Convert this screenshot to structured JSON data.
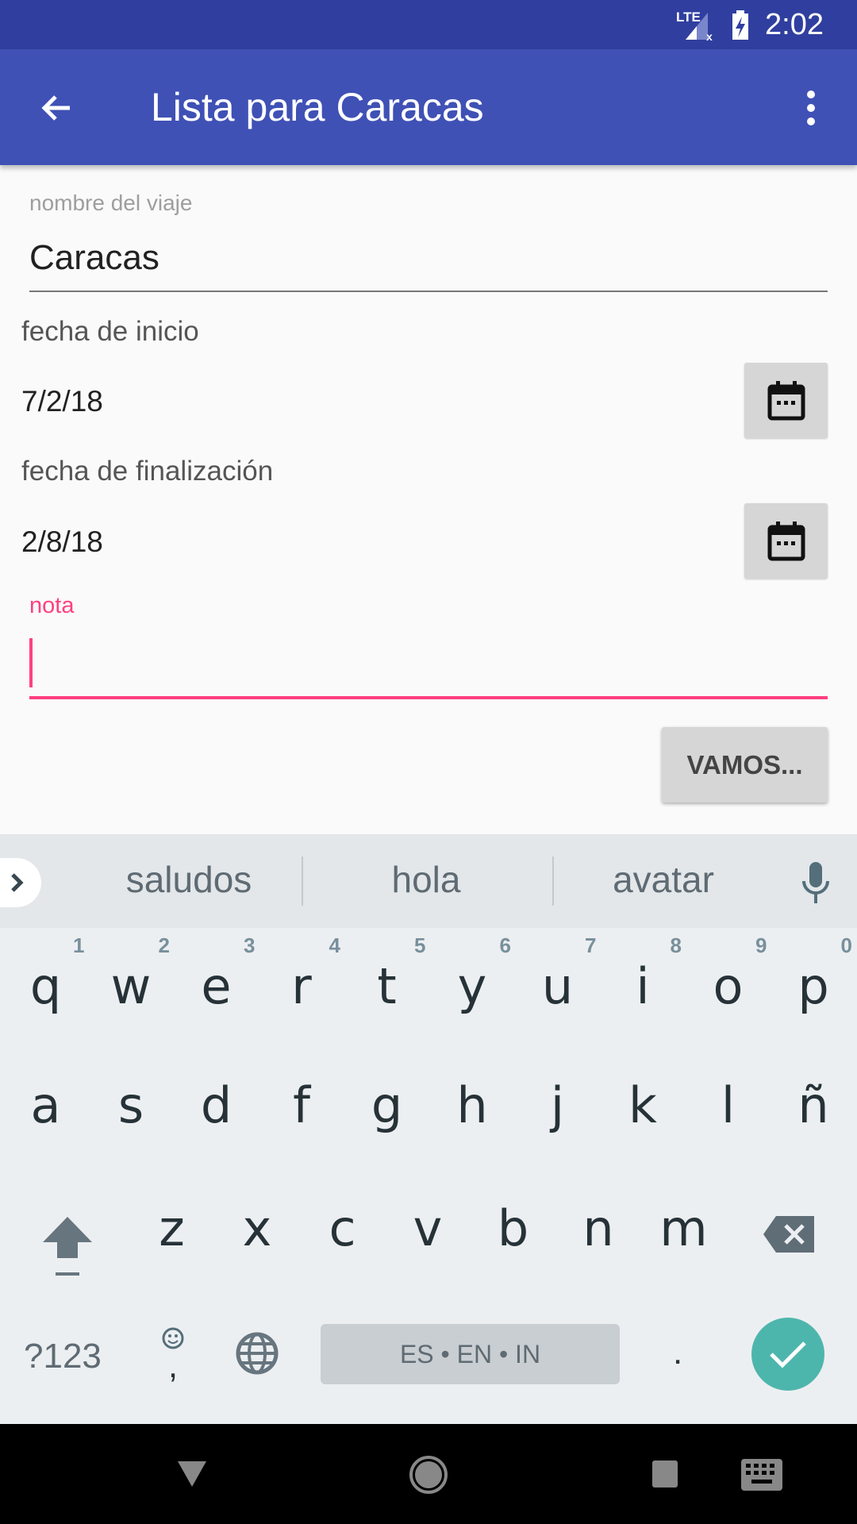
{
  "status_bar": {
    "network": "LTE",
    "time": "2:02"
  },
  "app_bar": {
    "title": "Lista para Caracas"
  },
  "form": {
    "trip_name_label": "nombre del viaje",
    "trip_name_value": "Caracas",
    "start_label": "fecha de inicio",
    "start_value": "7/2/18",
    "end_label": "fecha de finalización",
    "end_value": "2/8/18",
    "note_label": "nota",
    "note_value": "",
    "submit_label": "VAMOS..."
  },
  "keyboard": {
    "suggestions": [
      "saludos",
      "hola",
      "avatar"
    ],
    "row1": [
      "q",
      "w",
      "e",
      "r",
      "t",
      "y",
      "u",
      "i",
      "o",
      "p"
    ],
    "row1_nums": [
      "1",
      "2",
      "3",
      "4",
      "5",
      "6",
      "7",
      "8",
      "9",
      "0"
    ],
    "row2": [
      "a",
      "s",
      "d",
      "f",
      "g",
      "h",
      "j",
      "k",
      "l",
      "ñ"
    ],
    "row3": [
      "z",
      "x",
      "c",
      "v",
      "b",
      "n",
      "m"
    ],
    "symbols_label": "?123",
    "comma": ",",
    "space_label": "ES • EN • IN",
    "period": "."
  },
  "colors": {
    "primary": "#3f51b5",
    "primary_dark": "#303f9f",
    "accent": "#ff4081",
    "enter": "#4db6ac"
  }
}
